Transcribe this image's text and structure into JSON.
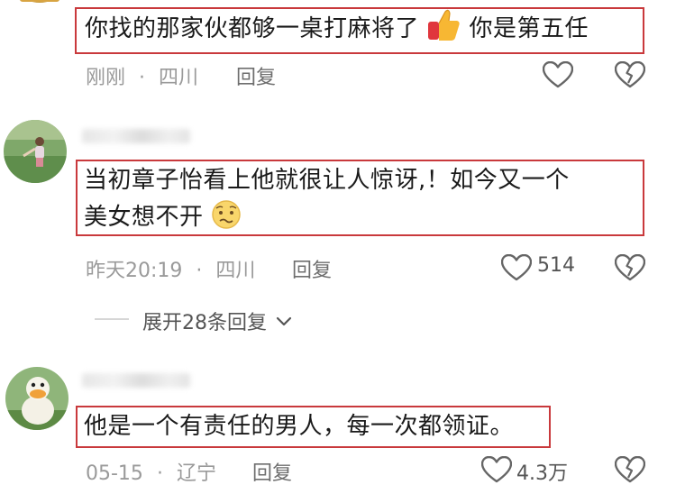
{
  "comments": [
    {
      "text": "你找的那家伙都够一桌打麻将了",
      "text_after": "你是第五任",
      "time": "刚刚",
      "location": "四川",
      "reply_label": "回复",
      "likes": ""
    },
    {
      "text_line1": "当初章子怡看上他就很让人惊讶,！如今又一个",
      "text_line2": "美女想不开",
      "time": "昨天20:19",
      "location": "四川",
      "reply_label": "回复",
      "likes": "514",
      "expand_label": "展开28条回复"
    },
    {
      "text": "他是一个有责任的男人，每一次都领证。",
      "time": "05-15",
      "location": "辽宁",
      "reply_label": "回复",
      "likes": "4.3万"
    }
  ],
  "separator": "·",
  "icons": [
    "thumbs-up-emoji",
    "woozy-face-emoji",
    "heart-icon",
    "broken-heart-icon",
    "chevron-down-icon"
  ],
  "colors": {
    "highlight_border": "#c9393c",
    "meta": "#9a9a9a"
  }
}
